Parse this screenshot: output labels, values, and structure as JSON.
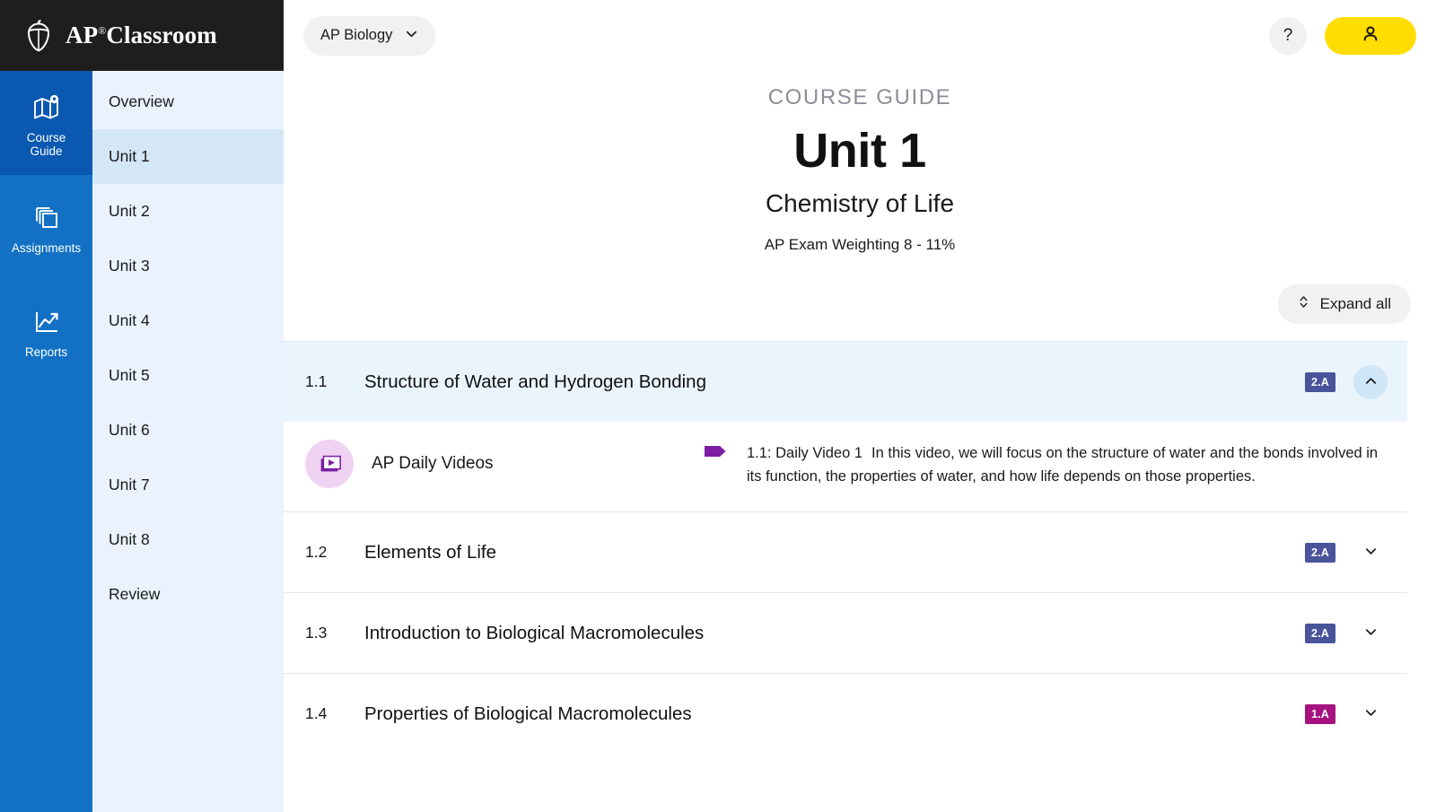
{
  "brand": {
    "name": "AP",
    "registered": "®",
    "product": "Classroom",
    "acorn_icon": "acorn-logo-icon"
  },
  "rail": {
    "items": [
      {
        "label_line1": "Course",
        "label_line2": "Guide",
        "icon": "map-guide-icon",
        "active": true
      },
      {
        "label_line1": "Assignments",
        "label_line2": "",
        "icon": "layers-icon",
        "active": false
      },
      {
        "label_line1": "Reports",
        "label_line2": "",
        "icon": "line-chart-icon",
        "active": false
      }
    ]
  },
  "unit_nav": {
    "items": [
      {
        "label": "Overview",
        "active": false
      },
      {
        "label": "Unit 1",
        "active": true
      },
      {
        "label": "Unit 2",
        "active": false
      },
      {
        "label": "Unit 3",
        "active": false
      },
      {
        "label": "Unit 4",
        "active": false
      },
      {
        "label": "Unit 5",
        "active": false
      },
      {
        "label": "Unit 6",
        "active": false
      },
      {
        "label": "Unit 7",
        "active": false
      },
      {
        "label": "Unit 8",
        "active": false
      },
      {
        "label": "Review",
        "active": false
      }
    ]
  },
  "topbar": {
    "course_selector": "AP Biology",
    "course_chevron_icon": "chevron-down-icon",
    "help_label": "?",
    "profile_icon": "user-person-icon"
  },
  "header": {
    "eyebrow": "COURSE GUIDE",
    "title": "Unit 1",
    "subtitle": "Chemistry of Life",
    "weighting": "AP Exam Weighting 8 - 11%"
  },
  "controls": {
    "expand_all": "Expand all",
    "expand_icon": "up-down-chevron-icon"
  },
  "topics": [
    {
      "number": "1.1",
      "name": "Structure of Water and Hydrogen Bonding",
      "badge": "2.A",
      "badge_color": "#49549b",
      "expanded": true,
      "chevron_icon": "chevron-up-icon",
      "resource": {
        "icon": "video-stack-play-icon",
        "label": "AP Daily Videos",
        "tag_icon": "purple-tag-icon",
        "video_title": "1.1: Daily Video 1",
        "video_description": "In this video, we will focus on the structure of water and the bonds involved in its function, the properties of water, and how life depends on those properties."
      }
    },
    {
      "number": "1.2",
      "name": "Elements of Life",
      "badge": "2.A",
      "badge_color": "#49549b",
      "expanded": false,
      "chevron_icon": "chevron-down-icon"
    },
    {
      "number": "1.3",
      "name": "Introduction to Biological Macromolecules",
      "badge": "2.A",
      "badge_color": "#49549b",
      "expanded": false,
      "chevron_icon": "chevron-down-icon"
    },
    {
      "number": "1.4",
      "name": "Properties of Biological Macromolecules",
      "badge": "1.A",
      "badge_color": "#a5127f",
      "expanded": false,
      "chevron_icon": "chevron-down-icon"
    }
  ],
  "colors": {
    "brand_black": "#1e1e1e",
    "rail_blue": "#1271c4",
    "rail_active_blue": "#0a58b0",
    "unit_nav_bg": "#eaf3fd",
    "unit_active_bg": "#d3e7f7",
    "accent_yellow": "#ffdd00",
    "badge_blue": "#49549b",
    "badge_magenta": "#a5127f",
    "expanded_row_bg": "#eaf4fd"
  }
}
